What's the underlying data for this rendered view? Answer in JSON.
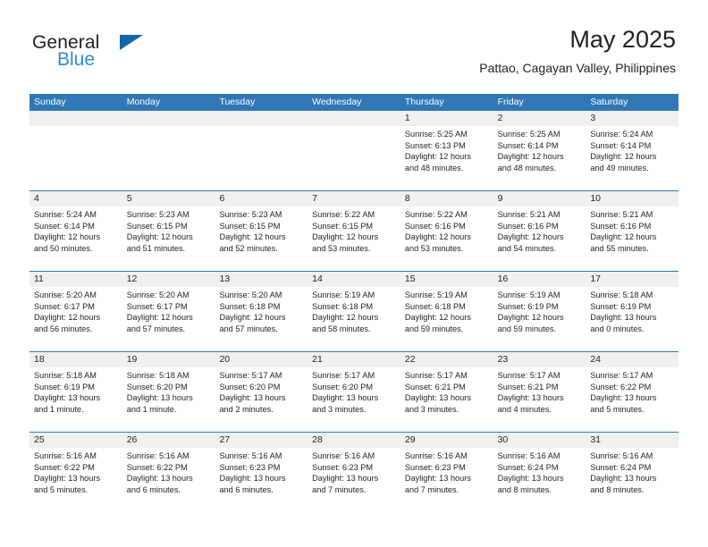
{
  "logo": {
    "primary_text": "General",
    "secondary_text": "Blue",
    "flag_icon": "triangle-flag-icon",
    "primary_color": "#231f20",
    "secondary_color": "#2e8bd8",
    "flag_color": "#1565a8"
  },
  "header": {
    "title": "May 2025",
    "subtitle": "Pattao, Cagayan Valley, Philippines"
  },
  "theme": {
    "header_blue": "#3077b8",
    "daynum_band": "#f0f0f0",
    "text": "#231f20"
  },
  "weekdays": [
    "Sunday",
    "Monday",
    "Tuesday",
    "Wednesday",
    "Thursday",
    "Friday",
    "Saturday"
  ],
  "weeks": [
    [
      {
        "day": "",
        "sunrise": "",
        "sunset": "",
        "daylight1": "",
        "daylight2": ""
      },
      {
        "day": "",
        "sunrise": "",
        "sunset": "",
        "daylight1": "",
        "daylight2": ""
      },
      {
        "day": "",
        "sunrise": "",
        "sunset": "",
        "daylight1": "",
        "daylight2": ""
      },
      {
        "day": "",
        "sunrise": "",
        "sunset": "",
        "daylight1": "",
        "daylight2": ""
      },
      {
        "day": "1",
        "sunrise": "Sunrise: 5:25 AM",
        "sunset": "Sunset: 6:13 PM",
        "daylight1": "Daylight: 12 hours",
        "daylight2": "and 48 minutes."
      },
      {
        "day": "2",
        "sunrise": "Sunrise: 5:25 AM",
        "sunset": "Sunset: 6:14 PM",
        "daylight1": "Daylight: 12 hours",
        "daylight2": "and 48 minutes."
      },
      {
        "day": "3",
        "sunrise": "Sunrise: 5:24 AM",
        "sunset": "Sunset: 6:14 PM",
        "daylight1": "Daylight: 12 hours",
        "daylight2": "and 49 minutes."
      }
    ],
    [
      {
        "day": "4",
        "sunrise": "Sunrise: 5:24 AM",
        "sunset": "Sunset: 6:14 PM",
        "daylight1": "Daylight: 12 hours",
        "daylight2": "and 50 minutes."
      },
      {
        "day": "5",
        "sunrise": "Sunrise: 5:23 AM",
        "sunset": "Sunset: 6:15 PM",
        "daylight1": "Daylight: 12 hours",
        "daylight2": "and 51 minutes."
      },
      {
        "day": "6",
        "sunrise": "Sunrise: 5:23 AM",
        "sunset": "Sunset: 6:15 PM",
        "daylight1": "Daylight: 12 hours",
        "daylight2": "and 52 minutes."
      },
      {
        "day": "7",
        "sunrise": "Sunrise: 5:22 AM",
        "sunset": "Sunset: 6:15 PM",
        "daylight1": "Daylight: 12 hours",
        "daylight2": "and 53 minutes."
      },
      {
        "day": "8",
        "sunrise": "Sunrise: 5:22 AM",
        "sunset": "Sunset: 6:16 PM",
        "daylight1": "Daylight: 12 hours",
        "daylight2": "and 53 minutes."
      },
      {
        "day": "9",
        "sunrise": "Sunrise: 5:21 AM",
        "sunset": "Sunset: 6:16 PM",
        "daylight1": "Daylight: 12 hours",
        "daylight2": "and 54 minutes."
      },
      {
        "day": "10",
        "sunrise": "Sunrise: 5:21 AM",
        "sunset": "Sunset: 6:16 PM",
        "daylight1": "Daylight: 12 hours",
        "daylight2": "and 55 minutes."
      }
    ],
    [
      {
        "day": "11",
        "sunrise": "Sunrise: 5:20 AM",
        "sunset": "Sunset: 6:17 PM",
        "daylight1": "Daylight: 12 hours",
        "daylight2": "and 56 minutes."
      },
      {
        "day": "12",
        "sunrise": "Sunrise: 5:20 AM",
        "sunset": "Sunset: 6:17 PM",
        "daylight1": "Daylight: 12 hours",
        "daylight2": "and 57 minutes."
      },
      {
        "day": "13",
        "sunrise": "Sunrise: 5:20 AM",
        "sunset": "Sunset: 6:18 PM",
        "daylight1": "Daylight: 12 hours",
        "daylight2": "and 57 minutes."
      },
      {
        "day": "14",
        "sunrise": "Sunrise: 5:19 AM",
        "sunset": "Sunset: 6:18 PM",
        "daylight1": "Daylight: 12 hours",
        "daylight2": "and 58 minutes."
      },
      {
        "day": "15",
        "sunrise": "Sunrise: 5:19 AM",
        "sunset": "Sunset: 6:18 PM",
        "daylight1": "Daylight: 12 hours",
        "daylight2": "and 59 minutes."
      },
      {
        "day": "16",
        "sunrise": "Sunrise: 5:19 AM",
        "sunset": "Sunset: 6:19 PM",
        "daylight1": "Daylight: 12 hours",
        "daylight2": "and 59 minutes."
      },
      {
        "day": "17",
        "sunrise": "Sunrise: 5:18 AM",
        "sunset": "Sunset: 6:19 PM",
        "daylight1": "Daylight: 13 hours",
        "daylight2": "and 0 minutes."
      }
    ],
    [
      {
        "day": "18",
        "sunrise": "Sunrise: 5:18 AM",
        "sunset": "Sunset: 6:19 PM",
        "daylight1": "Daylight: 13 hours",
        "daylight2": "and 1 minute."
      },
      {
        "day": "19",
        "sunrise": "Sunrise: 5:18 AM",
        "sunset": "Sunset: 6:20 PM",
        "daylight1": "Daylight: 13 hours",
        "daylight2": "and 1 minute."
      },
      {
        "day": "20",
        "sunrise": "Sunrise: 5:17 AM",
        "sunset": "Sunset: 6:20 PM",
        "daylight1": "Daylight: 13 hours",
        "daylight2": "and 2 minutes."
      },
      {
        "day": "21",
        "sunrise": "Sunrise: 5:17 AM",
        "sunset": "Sunset: 6:20 PM",
        "daylight1": "Daylight: 13 hours",
        "daylight2": "and 3 minutes."
      },
      {
        "day": "22",
        "sunrise": "Sunrise: 5:17 AM",
        "sunset": "Sunset: 6:21 PM",
        "daylight1": "Daylight: 13 hours",
        "daylight2": "and 3 minutes."
      },
      {
        "day": "23",
        "sunrise": "Sunrise: 5:17 AM",
        "sunset": "Sunset: 6:21 PM",
        "daylight1": "Daylight: 13 hours",
        "daylight2": "and 4 minutes."
      },
      {
        "day": "24",
        "sunrise": "Sunrise: 5:17 AM",
        "sunset": "Sunset: 6:22 PM",
        "daylight1": "Daylight: 13 hours",
        "daylight2": "and 5 minutes."
      }
    ],
    [
      {
        "day": "25",
        "sunrise": "Sunrise: 5:16 AM",
        "sunset": "Sunset: 6:22 PM",
        "daylight1": "Daylight: 13 hours",
        "daylight2": "and 5 minutes."
      },
      {
        "day": "26",
        "sunrise": "Sunrise: 5:16 AM",
        "sunset": "Sunset: 6:22 PM",
        "daylight1": "Daylight: 13 hours",
        "daylight2": "and 6 minutes."
      },
      {
        "day": "27",
        "sunrise": "Sunrise: 5:16 AM",
        "sunset": "Sunset: 6:23 PM",
        "daylight1": "Daylight: 13 hours",
        "daylight2": "and 6 minutes."
      },
      {
        "day": "28",
        "sunrise": "Sunrise: 5:16 AM",
        "sunset": "Sunset: 6:23 PM",
        "daylight1": "Daylight: 13 hours",
        "daylight2": "and 7 minutes."
      },
      {
        "day": "29",
        "sunrise": "Sunrise: 5:16 AM",
        "sunset": "Sunset: 6:23 PM",
        "daylight1": "Daylight: 13 hours",
        "daylight2": "and 7 minutes."
      },
      {
        "day": "30",
        "sunrise": "Sunrise: 5:16 AM",
        "sunset": "Sunset: 6:24 PM",
        "daylight1": "Daylight: 13 hours",
        "daylight2": "and 8 minutes."
      },
      {
        "day": "31",
        "sunrise": "Sunrise: 5:16 AM",
        "sunset": "Sunset: 6:24 PM",
        "daylight1": "Daylight: 13 hours",
        "daylight2": "and 8 minutes."
      }
    ]
  ]
}
